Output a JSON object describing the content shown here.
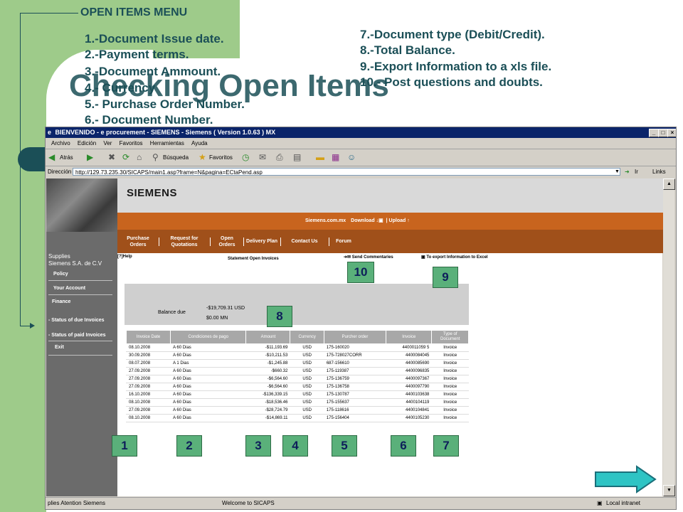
{
  "slide": {
    "menu_title": "OPEN ITEMS MENU",
    "menu_items_left": [
      "1.-Document Issue date.",
      "2.-Payment terms.",
      "3.-Document Ammount.",
      "4.- Currency",
      "5.- Purchase Order Number.",
      "6.- Document Number."
    ],
    "menu_items_right": [
      "7.-Document type (Debit/Credit).",
      "8.-Total Balance.",
      "9.-Export Information to a xls file.",
      "10.- Post questions and doubts."
    ],
    "title": "Checking Open Items",
    "badges": [
      "1",
      "2",
      "3",
      "4",
      "5",
      "6",
      "7",
      "8",
      "9",
      "10"
    ]
  },
  "browser": {
    "title": "BIENVENIDO - e procurement - SIEMENS - Siemens ( Version 1.0.63 ) MX",
    "menu": [
      "Archivo",
      "Edición",
      "Ver",
      "Favoritos",
      "Herramientas",
      "Ayuda"
    ],
    "toolbar": {
      "back": "Atrás",
      "search": "Búsqueda",
      "favorites": "Favoritos"
    },
    "address_label": "Dirección",
    "address": "http://129.73.235.30/SICAPS/main1.asp?frame=N&pagina=ECtaPend.asp",
    "go_label": "Ir",
    "links_label": "Links",
    "status_left": "plies Atention Siemens",
    "status_mid": "Welcome to SICAPS",
    "status_right": "Local intranet"
  },
  "site": {
    "logo": "SIEMENS",
    "top_links": {
      "site": "Siemens.com.mx",
      "download": "Download",
      "upload": "Upload"
    },
    "nav": [
      "Purchase Orders",
      "Request for Quotations",
      "Open Orders",
      "Delivery Plan",
      "Contact Us",
      "Forum"
    ],
    "supplier": [
      "Supplies",
      "Siemens S.A. de C.V"
    ],
    "left_menu": [
      "Policy",
      "Your Account",
      "Finance",
      "- Status of due Invoices",
      "- Status of paid Invoices",
      "Exit"
    ],
    "help": "Help",
    "statement_title": "Statement Open Invoices",
    "send_comments": "Send Commentaries",
    "export": "To export Information to Excel",
    "balance_label": "Balance due",
    "balance_usd": "-$19,709.31 USD",
    "balance_mn": "$0.00 MN"
  },
  "table": {
    "headers": [
      "Invoice Date",
      "Condiciones de pago",
      "Amount",
      "Currency",
      "Purcher order",
      "Invoice",
      "Type of Document"
    ],
    "rows": [
      [
        "08.10.2008",
        "A 60 Dias",
        "-$11,193.69",
        "USD",
        "175-160020",
        "4400011059 5",
        "Invoice"
      ],
      [
        "30.09.2008",
        "A 60 Dias",
        "-$10,211.53",
        "USD",
        "175-728027CORR",
        "4400084045",
        "Invoice"
      ],
      [
        "08.07.2008",
        "A 1 Dias",
        "-$1,245.88",
        "USD",
        "687-156610",
        "4400085690",
        "Invoice"
      ],
      [
        "27.09.2008",
        "A 60 Dias",
        "-$660.32",
        "USD",
        "175-119387",
        "4400096835",
        "Invoice"
      ],
      [
        "27.09.2008",
        "A 60 Dias",
        "-$6,564.60",
        "USD",
        "175-136759",
        "4400097367",
        "Invoice"
      ],
      [
        "27.09.2008",
        "A 60 Dias",
        "-$6,564.60",
        "USD",
        "175-136758",
        "4400097790",
        "Invoice"
      ],
      [
        "16.10.2008",
        "A 60 Dias",
        "-$136,339.15",
        "USD",
        "175-130787",
        "4400103638",
        "Invoice"
      ],
      [
        "08.10.2008",
        "A 60 Dias",
        "-$18,536.46",
        "USD",
        "175-155637",
        "4400104119",
        "Invoice"
      ],
      [
        "27.09.2008",
        "A 60 Dias",
        "-$28,724.79",
        "USD",
        "175-118616",
        "4400104841",
        "Invoice"
      ],
      [
        "08.10.2008",
        "A 60 Dias",
        "-$14,869.11",
        "USD",
        "175-156404",
        "4400105230",
        "Invoice"
      ]
    ]
  }
}
